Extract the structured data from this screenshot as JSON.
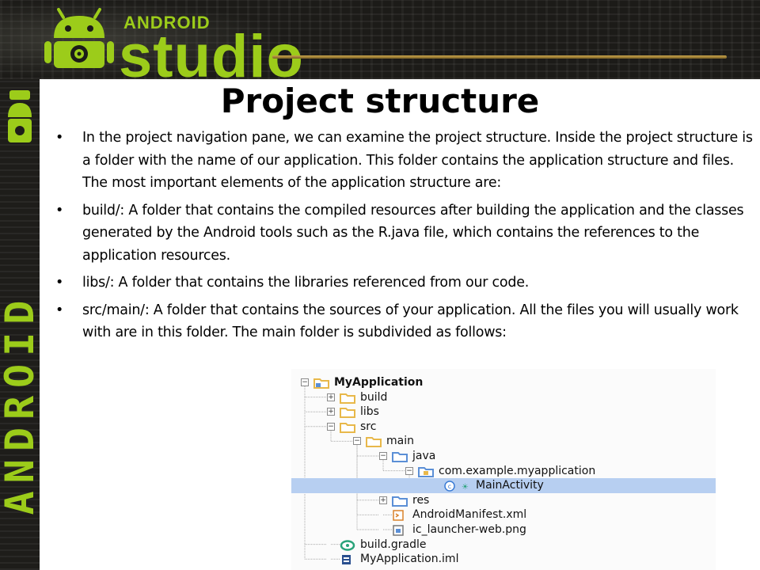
{
  "banner": {
    "brand_small": "ANDROID",
    "brand_big": "studio",
    "strip_text": "ANDROID"
  },
  "slide": {
    "title": "Project structure",
    "bullets": [
      "In the project navigation pane, we can examine the project structure. Inside the project structure is a folder with the name of our application. This folder contains the application structure and files. The most important elements of the application structure are:",
      "build/: A folder that contains the compiled resources after building the application and the classes generated by the Android tools such as the R.java file, which contains the references to the application resources.",
      "libs/: A folder that contains the libraries referenced from our code.",
      "src/main/: A folder that contains the sources of your application. All the files you will usually work with are in this folder. The main folder is subdivided as follows:"
    ]
  },
  "tree": {
    "items": [
      {
        "label": "MyApplication",
        "icon": "project-folder-icon",
        "toggle": "minus"
      },
      {
        "label": "build",
        "icon": "folder-icon",
        "toggle": "plus"
      },
      {
        "label": "libs",
        "icon": "folder-icon",
        "toggle": "plus"
      },
      {
        "label": "src",
        "icon": "folder-icon",
        "toggle": "minus"
      },
      {
        "label": "main",
        "icon": "folder-icon",
        "toggle": "minus"
      },
      {
        "label": "java",
        "icon": "source-folder-icon",
        "toggle": "minus"
      },
      {
        "label": "com.example.myapplication",
        "icon": "package-icon",
        "toggle": "minus"
      },
      {
        "label": "MainActivity",
        "icon": "class-icon",
        "toggle": "none"
      },
      {
        "label": "res",
        "icon": "source-folder-icon",
        "toggle": "plus"
      },
      {
        "label": "AndroidManifest.xml",
        "icon": "xml-file-icon",
        "toggle": "none"
      },
      {
        "label": "ic_launcher-web.png",
        "icon": "image-file-icon",
        "toggle": "none"
      },
      {
        "label": "build.gradle",
        "icon": "gradle-icon",
        "toggle": "none"
      },
      {
        "label": "MyApplication.iml",
        "icon": "iml-file-icon",
        "toggle": "none"
      }
    ],
    "selected_index": 7,
    "colors": {
      "folder": "#e8b84a",
      "source_folder": "#5b8fd6",
      "selection": "#b7cff1",
      "gradle": "#2aa37a"
    }
  }
}
